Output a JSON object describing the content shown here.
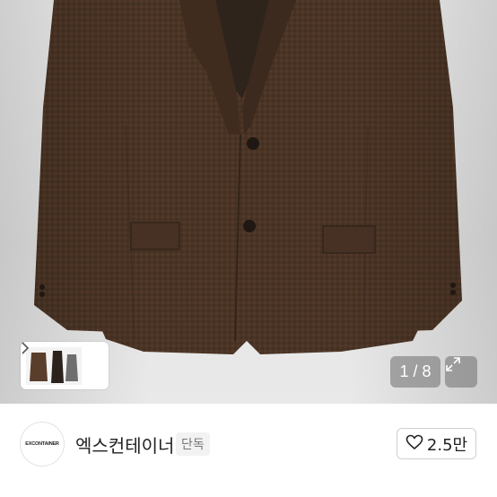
{
  "gallery": {
    "counter": "1 / 8",
    "icons": {
      "next": "chevron-right-icon",
      "expand": "expand-arrows-icon"
    }
  },
  "seller": {
    "avatar_logo_text": "EXCONTAINER",
    "name": "엑스컨테이너",
    "badge": "단독",
    "likes": "2.5만",
    "icons": {
      "like": "heart-outline-icon"
    }
  },
  "colors": {
    "jacket": "#4a3426",
    "background": "#e7e7e7"
  }
}
